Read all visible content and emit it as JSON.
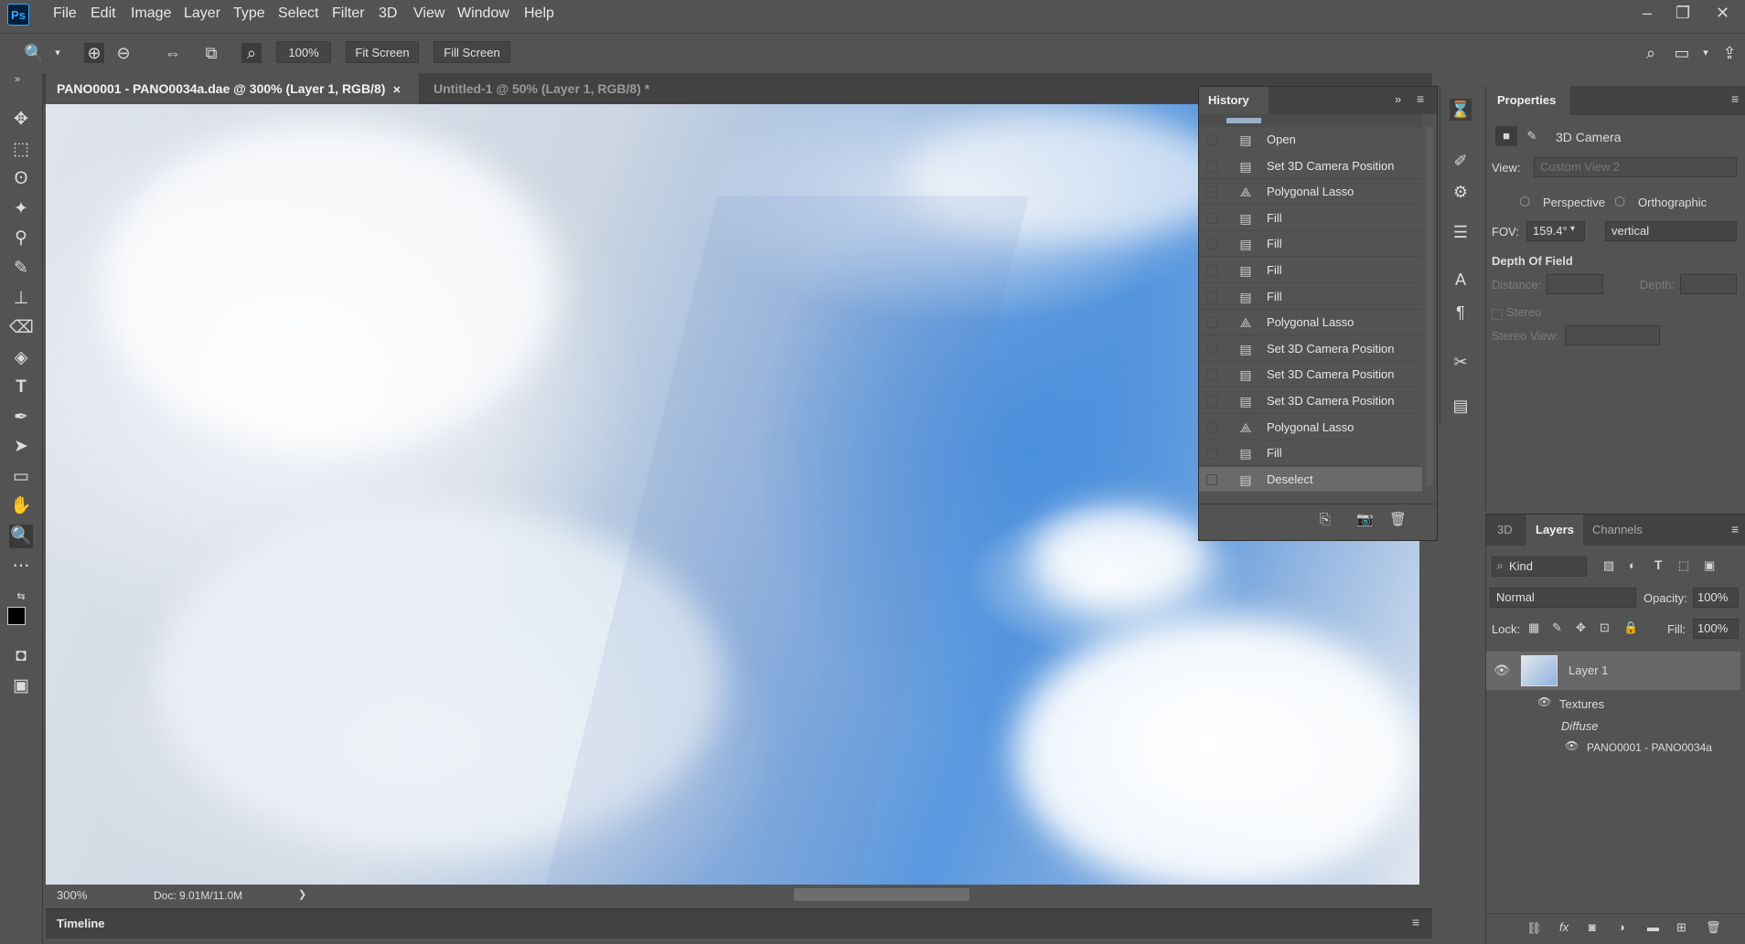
{
  "app": {
    "logo": "Ps"
  },
  "menu": [
    "File",
    "Edit",
    "Image",
    "Layer",
    "Type",
    "Select",
    "Filter",
    "3D",
    "View",
    "Window",
    "Help"
  ],
  "window_controls": {
    "minimize": "–",
    "restore": "❐",
    "close": "✕"
  },
  "options": {
    "zoom_value": "100%",
    "fit_screen": "Fit Screen",
    "fill_screen": "Fill Screen"
  },
  "tabs": [
    {
      "label": "PANO0001 - PANO0034a.dae @ 300% (Layer 1, RGB/8)",
      "close": "✕"
    },
    {
      "label": "Untitled-1 @ 50% (Layer 1, RGB/8) *",
      "close": "✕"
    }
  ],
  "status": {
    "zoom": "300%",
    "doc": "Doc: 9.01M/11.0M",
    "arrow": "❯"
  },
  "timeline": {
    "label": "Timeline"
  },
  "history": {
    "title": "History",
    "items": [
      {
        "icon": "doc-icon",
        "label": "Open"
      },
      {
        "icon": "doc-icon",
        "label": "Set 3D Camera Position"
      },
      {
        "icon": "lasso-icon",
        "label": "Polygonal Lasso"
      },
      {
        "icon": "doc-icon",
        "label": "Fill"
      },
      {
        "icon": "doc-icon",
        "label": "Fill"
      },
      {
        "icon": "doc-icon",
        "label": "Fill"
      },
      {
        "icon": "doc-icon",
        "label": "Fill"
      },
      {
        "icon": "lasso-icon",
        "label": "Polygonal Lasso"
      },
      {
        "icon": "doc-icon",
        "label": "Set 3D Camera Position"
      },
      {
        "icon": "doc-icon",
        "label": "Set 3D Camera Position"
      },
      {
        "icon": "doc-icon",
        "label": "Set 3D Camera Position"
      },
      {
        "icon": "lasso-icon",
        "label": "Polygonal Lasso"
      },
      {
        "icon": "doc-icon",
        "label": "Fill"
      },
      {
        "icon": "doc-icon",
        "label": "Deselect"
      }
    ],
    "selected_index": 13
  },
  "properties": {
    "title": "Properties",
    "section": "3D Camera",
    "view_label": "View:",
    "view_value": "Custom View 2",
    "perspective": "Perspective",
    "orthographic": "Orthographic",
    "fov_label": "FOV:",
    "fov_value": "159.4°",
    "fov_axis": "vertical",
    "dof_title": "Depth Of Field",
    "distance_label": "Distance:",
    "depth_label": "Depth:",
    "stereo_label": "Stereo",
    "stereo_view_label": "Stereo View:"
  },
  "layers": {
    "tabs": [
      "3D",
      "Layers",
      "Channels"
    ],
    "active_tab": "Layers",
    "filter": "Kind",
    "blend_mode": "Normal",
    "opacity_label": "Opacity:",
    "opacity_value": "100%",
    "lock_label": "Lock:",
    "fill_label": "Fill:",
    "fill_value": "100%",
    "layer_name": "Layer 1",
    "textures": "Textures",
    "diffuse": "Diffuse",
    "texture_file": "PANO0001 - PANO0034a"
  },
  "colors": {
    "accent": "#31a8ff",
    "panel": "#535353",
    "dark": "#424242",
    "sky": "#5a98df"
  }
}
